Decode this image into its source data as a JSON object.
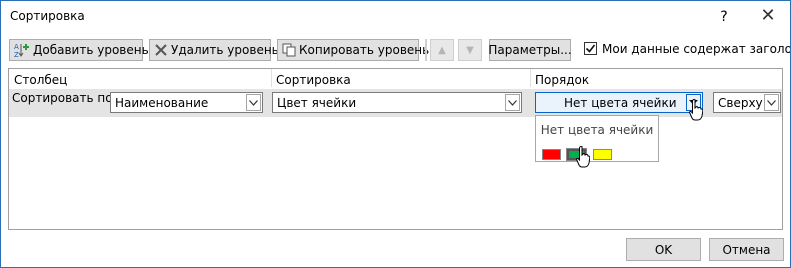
{
  "window": {
    "title": "Сортировка",
    "help": "?",
    "close": "✕"
  },
  "toolbar": {
    "add_level": "Добавить уровень",
    "delete_level": "Удалить уровень",
    "copy_level": "Копировать уровень",
    "options": "Параметры...",
    "move_up": "▲",
    "move_down": "▼"
  },
  "headers_checkbox": {
    "label": "Мои данные содержат заголовки",
    "checked": true
  },
  "columns": {
    "column": "Столбец",
    "sort_on": "Сортировка",
    "order": "Порядок"
  },
  "sort_row": {
    "label": "Сортировать по",
    "column_value": "Наименование",
    "sort_on_value": "Цвет ячейки",
    "order_value": "Нет цвета ячейки",
    "position_value": "Сверху"
  },
  "color_popup": {
    "no_color": "Нет цвета ячейки",
    "swatches": [
      {
        "name": "red",
        "color": "#ff0000"
      },
      {
        "name": "green",
        "color": "#00b050"
      },
      {
        "name": "yellow",
        "color": "#ffff00"
      }
    ]
  },
  "footer": {
    "ok": "OK",
    "cancel": "Отмена"
  }
}
